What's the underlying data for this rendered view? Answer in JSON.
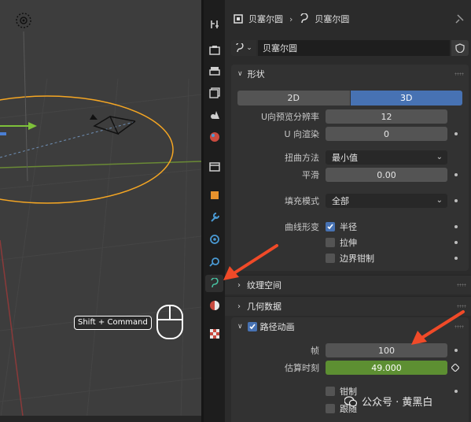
{
  "viewport": {
    "shortcut_label": "Shift + Command",
    "icons": [
      "light-icon",
      "camera-icon",
      "mouse-icon",
      "empty-axis-icon"
    ]
  },
  "tabs": [
    "tool-icon",
    "render-icon",
    "output-icon",
    "view-layer-icon",
    "scene-icon",
    "world-icon",
    "collection-icon",
    "object-icon",
    "modifier-icon",
    "particles-icon",
    "physics-icon",
    "curve-data-icon",
    "material-icon",
    "texture-icon"
  ],
  "header": {
    "object_name": "贝塞尔圆",
    "data_name": "贝塞尔圆",
    "icons": [
      "object-icon",
      "curve-icon",
      "pin-icon"
    ]
  },
  "datablock": {
    "name": "贝塞尔圆",
    "icons": [
      "curve-icon",
      "chevron-down-icon",
      "shield-icon"
    ]
  },
  "shape": {
    "title": "形状",
    "mode_2d": "2D",
    "mode_3d": "3D",
    "active_mode": "3D",
    "u_preview_label": "U向预览分辨率",
    "u_preview_value": "12",
    "u_render_label": "U 向渲染",
    "u_render_value": "0",
    "twist_label": "扭曲方法",
    "twist_value": "最小值",
    "smooth_label": "平滑",
    "smooth_value": "0.00",
    "fill_label": "填充模式",
    "fill_value": "全部",
    "deform_label": "曲线形变",
    "radius_label": "半径",
    "radius_checked": true,
    "stretch_label": "拉伸",
    "stretch_checked": false,
    "clamp_label": "边界钳制",
    "clamp_checked": false
  },
  "texture_space": {
    "title": "纹理空间"
  },
  "geometry": {
    "title": "几何数据"
  },
  "path_anim": {
    "title": "路径动画",
    "enabled": true,
    "frames_label": "帧",
    "frames_value": "100",
    "eval_time_label": "估算时刻",
    "eval_time_value": "49.000",
    "clamp_label": "钳制",
    "follow_label": "跟随"
  },
  "watermark": {
    "text": "公众号 · 黄黑白"
  },
  "colors": {
    "accent": "#4772b3",
    "keyframed": "#5d8f32",
    "arrow": "#f04a28",
    "curve": "#f5a623"
  }
}
